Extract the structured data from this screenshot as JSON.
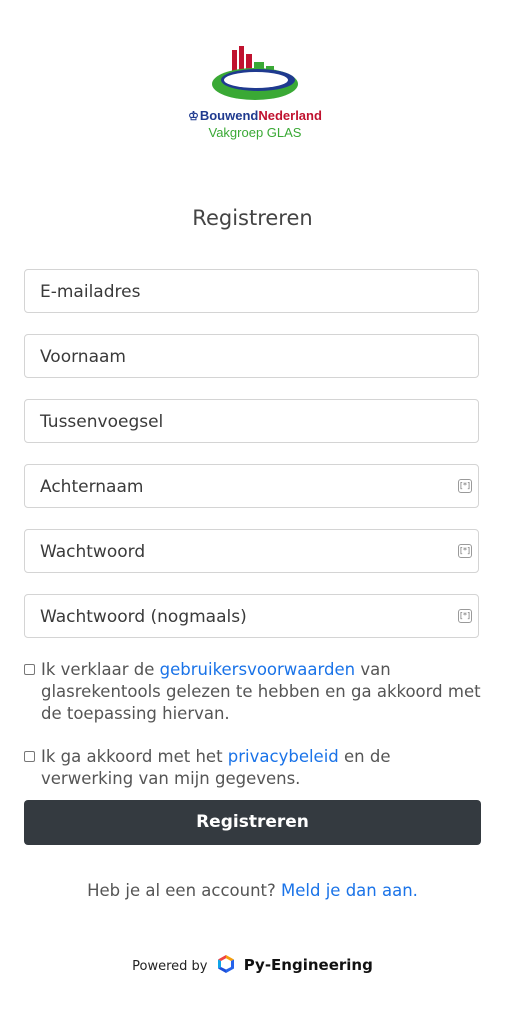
{
  "header": {
    "brand_part1": "Bouwend",
    "brand_part2": "Nederland",
    "brand_crown": "♔",
    "subtitle": "Vakgroep GLAS",
    "colors": {
      "blue": "#1f3a8f",
      "red": "#c0122f",
      "green": "#3aa935"
    }
  },
  "form": {
    "title": "Registreren",
    "fields": {
      "email": "E-mailadres",
      "first_name": "Voornaam",
      "infix": "Tussenvoegsel",
      "last_name": "Achternaam",
      "password": "Wachtwoord",
      "password_repeat": "Wachtwoord (nogmaals)"
    },
    "key_icon_text": "[*]",
    "terms": {
      "before": "Ik verklaar de ",
      "link": "gebruikersvoorwaarden",
      "after": " van glasrekentools gelezen te hebben en ga akkoord met de toepassing hiervan."
    },
    "privacy": {
      "before": "Ik ga akkoord met het ",
      "link": "privacybeleid",
      "after": " en de verwerking van mijn gegevens."
    },
    "submit_label": "Registreren"
  },
  "login": {
    "text": "Heb je al een account? ",
    "link": "Meld je dan aan."
  },
  "footer": {
    "powered_by": "Powered by",
    "company": "Py-Engineering"
  }
}
